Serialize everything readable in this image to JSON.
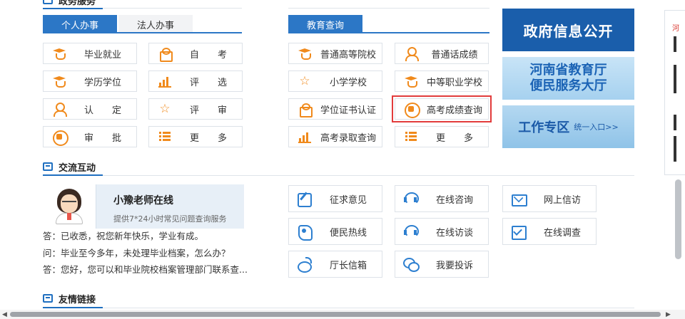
{
  "gov_services": {
    "title": "政务服务",
    "tabs": [
      {
        "label": "个人办事",
        "active": true
      },
      {
        "label": "法人办事",
        "active": false
      }
    ],
    "items": [
      {
        "label": "毕业就业",
        "icon": "graduation-cap-icon"
      },
      {
        "label": "自　　考",
        "icon": "gift-icon"
      },
      {
        "label": "学历学位",
        "icon": "graduation-cap-icon"
      },
      {
        "label": "评　　选",
        "icon": "bar-chart-icon"
      },
      {
        "label": "认　　定",
        "icon": "person-icon"
      },
      {
        "label": "评　　审",
        "icon": "star-icon"
      },
      {
        "label": "审　　批",
        "icon": "seal-icon"
      },
      {
        "label": "更　　多",
        "icon": "list-icon"
      }
    ]
  },
  "edu_query": {
    "tab": "教育查询",
    "items": [
      {
        "label": "普通高等院校",
        "icon": "graduation-cap-icon"
      },
      {
        "label": "普通话成绩",
        "icon": "person-icon"
      },
      {
        "label": "小学学校",
        "icon": "star-icon"
      },
      {
        "label": "中等职业学校",
        "icon": "graduation-cap-icon"
      },
      {
        "label": "学位证书认证",
        "icon": "gift-icon"
      },
      {
        "label": "高考成绩查询",
        "icon": "seal-icon",
        "highlighted": true
      },
      {
        "label": "高考录取查询",
        "icon": "bar-chart-icon"
      },
      {
        "label": "更　　多",
        "icon": "list-icon"
      }
    ]
  },
  "banners": {
    "gov_info": "政府信息公开",
    "service_hall_line1": "河南省教育厅",
    "service_hall_line2": "便民服务大厅",
    "work_zone": "工作专区",
    "work_zone_sub": "统一入口>>"
  },
  "interaction": {
    "title": "交流互动",
    "teacher": {
      "name": "小豫老师在线",
      "desc": "提供7*24小时常见问题查询服务"
    },
    "qa": [
      "答：已收悉，祝您新年快乐，学业有成。",
      "问：毕业至今多年，未处理毕业档案，怎么办？",
      "答：您好，您可以和毕业院校档案管理部门联系查..."
    ],
    "buttons": [
      {
        "label": "征求意见",
        "icon": "edit-icon"
      },
      {
        "label": "在线咨询",
        "icon": "headset-icon"
      },
      {
        "label": "网上信访",
        "icon": "mail-icon"
      },
      {
        "label": "便民热线",
        "icon": "phone-icon"
      },
      {
        "label": "在线访谈",
        "icon": "headset-icon"
      },
      {
        "label": "在线调查",
        "icon": "checklist-icon"
      },
      {
        "label": "厅长信箱",
        "icon": "weibo-icon"
      },
      {
        "label": "我要投诉",
        "icon": "chat-icon"
      }
    ]
  },
  "links": {
    "title": "友情链接"
  },
  "side_panel": {
    "text": "河"
  },
  "colors": {
    "primary_blue": "#2c77c6",
    "orange_icon": "#f08a1c",
    "highlight_red": "#e23b3b"
  }
}
